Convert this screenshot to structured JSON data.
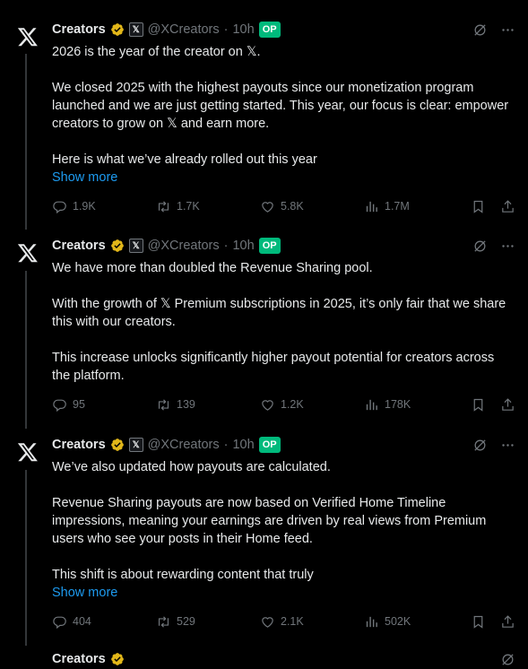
{
  "tweets": [
    {
      "author": "Creators",
      "affiliation_badge": "𝕏",
      "handle": "@XCreators",
      "separator": "·",
      "time": "10h",
      "op_badge": "OP",
      "paragraphs": [
        "2026 is the year of the creator on 𝕏.",
        "We closed 2025 with the highest payouts since our monetization program launched and we are just getting started. This year, our focus is clear: empower creators to grow on 𝕏 and earn more.",
        "Here is what we’ve already rolled out this year"
      ],
      "show_more": "Show more",
      "replies": "1.9K",
      "reposts": "1.7K",
      "likes": "5.8K",
      "views": "1.7M"
    },
    {
      "author": "Creators",
      "affiliation_badge": "𝕏",
      "handle": "@XCreators",
      "separator": "·",
      "time": "10h",
      "op_badge": "OP",
      "paragraphs": [
        "We have more than doubled the Revenue Sharing pool.",
        "With the growth of 𝕏 Premium subscriptions in 2025, it’s only fair that we share this with our creators.",
        "This increase unlocks significantly higher payout potential for creators across the platform."
      ],
      "show_more": "",
      "replies": "95",
      "reposts": "139",
      "likes": "1.2K",
      "views": "178K"
    },
    {
      "author": "Creators",
      "affiliation_badge": "𝕏",
      "handle": "@XCreators",
      "separator": "·",
      "time": "10h",
      "op_badge": "OP",
      "paragraphs": [
        "We’ve also updated how payouts are calculated.",
        "Revenue Sharing payouts are now based on Verified Home Timeline impressions, meaning your earnings are driven by real views from Premium users who see your posts in their Home feed.",
        "This shift is about rewarding content that truly"
      ],
      "show_more": "Show more",
      "replies": "404",
      "reposts": "529",
      "likes": "2.1K",
      "views": "502K"
    },
    {
      "author": "Creators"
    }
  ],
  "colors": {
    "background": "#000000",
    "text": "#e7e9ea",
    "muted": "#71767b",
    "link": "#1d9bf0",
    "op_badge": "#00ba7c",
    "verified": "#e2b719"
  },
  "icons": {
    "avatar": "x-logo-icon",
    "verified": "verified-badge-icon",
    "grok": "grok-icon",
    "more": "more-icon",
    "reply": "reply-icon",
    "repost": "repost-icon",
    "like": "heart-icon",
    "views": "views-icon",
    "bookmark": "bookmark-icon",
    "share": "share-icon"
  }
}
